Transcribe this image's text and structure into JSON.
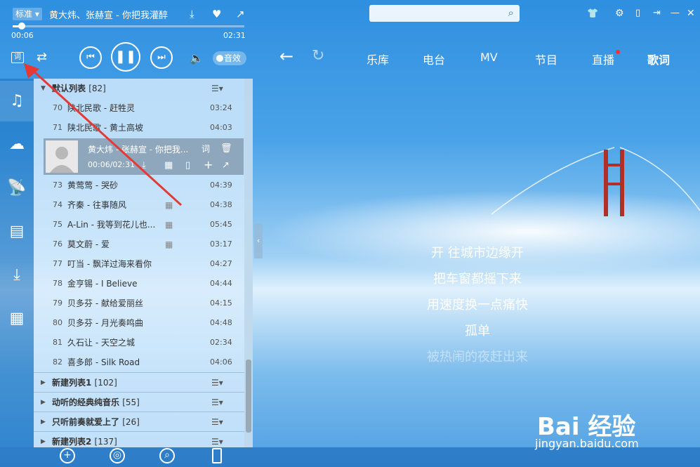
{
  "player": {
    "mode": "标准",
    "song": "黄大炜、张赫宣 - 你把我灌醉",
    "elapsed": "00:06",
    "total": "02:31",
    "progress": 0.04,
    "sound_effect": "音效"
  },
  "nav": {
    "items": [
      "乐库",
      "电台",
      "MV",
      "节目",
      "直播",
      "歌词"
    ],
    "active": "歌词",
    "live_dot_color": "#ff3030"
  },
  "playlist": {
    "header": {
      "title": "默认列表",
      "count": "[82]"
    },
    "rows": [
      {
        "n": "70",
        "title": "陕北民歌 - 赶牲灵",
        "dur": "03:24",
        "mv": false
      },
      {
        "n": "71",
        "title": "陕北民歌 - 黄土高坡",
        "dur": "04:03",
        "mv": false
      },
      {
        "n": "73",
        "title": "黄莺莺 - 哭砂",
        "dur": "04:39",
        "mv": false
      },
      {
        "n": "74",
        "title": "齐秦 - 往事随风",
        "dur": "04:38",
        "mv": true
      },
      {
        "n": "75",
        "title": "A-Lin - 我等到花儿也...",
        "dur": "05:45",
        "mv": true
      },
      {
        "n": "76",
        "title": "莫文蔚 - 爱",
        "dur": "03:17",
        "mv": true
      },
      {
        "n": "77",
        "title": "叮当 - 飘洋过海来看你",
        "dur": "04:27",
        "mv": false
      },
      {
        "n": "78",
        "title": "金亨锡 - I Believe",
        "dur": "04:44",
        "mv": false
      },
      {
        "n": "79",
        "title": "贝多芬 - 献给爱丽丝",
        "dur": "04:15",
        "mv": false
      },
      {
        "n": "80",
        "title": "贝多芬 - 月光奏鸣曲",
        "dur": "04:48",
        "mv": false
      },
      {
        "n": "81",
        "title": "久石让 - 天空之城",
        "dur": "02:34",
        "mv": false
      },
      {
        "n": "82",
        "title": "喜多郎 - Silk Road",
        "dur": "04:06",
        "mv": false
      }
    ],
    "current": {
      "title": "黄大炜 - 张赫宣 - 你把我...",
      "time": "00:06/02:31"
    },
    "groups": [
      {
        "title": "新建列表1",
        "count": "[102]"
      },
      {
        "title": "动听的经典纯音乐",
        "count": "[55]"
      },
      {
        "title": "只听前奏就爱上了",
        "count": "[26]"
      },
      {
        "title": "新建列表2",
        "count": "[137]"
      }
    ]
  },
  "lyrics": [
    "开 往城市边缘开",
    "把车窗都摇下来",
    "用速度换一点痛快",
    "孤单",
    "被热闹的夜赶出来"
  ],
  "icons": [
    "lyrics-toggle-icon",
    "shuffle-icon",
    "prev-icon",
    "pause-icon",
    "next-icon",
    "volume-icon",
    "download-icon",
    "heart-icon",
    "share-icon",
    "search-icon",
    "back-icon",
    "refresh-icon",
    "shirt-icon",
    "gear-icon",
    "phone-icon",
    "mini-mode-icon",
    "minimize-icon",
    "close-icon",
    "music-note-icon",
    "cloud-icon",
    "radio-icon",
    "library-icon",
    "download-tray-icon",
    "apps-icon",
    "add-icon",
    "locate-icon",
    "find-icon",
    "mobile-icon"
  ],
  "watermark": {
    "brand": "Bai 经验",
    "url": "jingyan.baidu.com"
  },
  "annotation_arrow_color": "#e53935"
}
